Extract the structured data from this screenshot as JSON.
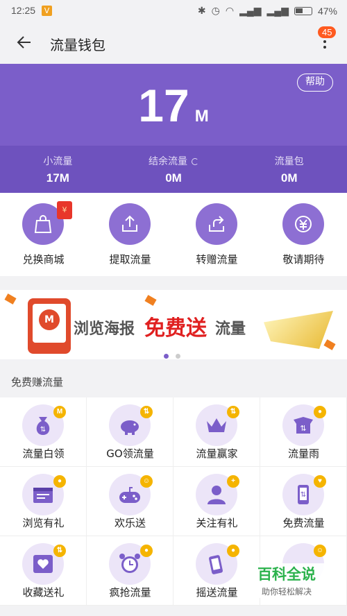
{
  "status_bar": {
    "time": "12:25",
    "notif_badge": "V",
    "battery": "47%"
  },
  "header": {
    "title": "流量钱包",
    "notif_count": "45"
  },
  "hero": {
    "help_label": "帮助",
    "amount": "17",
    "unit": "M",
    "stats": [
      {
        "label": "小流量",
        "value": "17M"
      },
      {
        "label": "结余流量",
        "value": "0M"
      },
      {
        "label": "流量包",
        "value": "0M"
      }
    ]
  },
  "actions": [
    {
      "label": "兑换商城",
      "icon": "shopping-bag-icon",
      "extra": "¥"
    },
    {
      "label": "提取流量",
      "icon": "upload-icon"
    },
    {
      "label": "转赠流量",
      "icon": "share-icon"
    },
    {
      "label": "敬请期待",
      "icon": "yuan-coin-icon"
    }
  ],
  "banner": {
    "text_before": "浏览海报",
    "text_highlight": "免费送",
    "text_after": "流量",
    "logo_letter": "M"
  },
  "earn_section": {
    "title": "免费赚流量",
    "items": [
      {
        "label": "流量白领",
        "icon": "money-bag-icon",
        "badge": "M"
      },
      {
        "label": "GO领流量",
        "icon": "piggy-bank-icon",
        "badge": "⇅"
      },
      {
        "label": "流量赢家",
        "icon": "crown-icon",
        "badge": "⇅"
      },
      {
        "label": "流量雨",
        "icon": "rain-icon",
        "badge": "●"
      },
      {
        "label": "浏览有礼",
        "icon": "browser-window-icon",
        "badge": "●"
      },
      {
        "label": "欢乐送",
        "icon": "gamepad-icon",
        "badge": "☺"
      },
      {
        "label": "关注有礼",
        "icon": "user-follow-icon",
        "badge": "+"
      },
      {
        "label": "免费流量",
        "icon": "phone-data-icon",
        "badge": "♥"
      },
      {
        "label": "收藏送礼",
        "icon": "heart-card-icon",
        "badge": "⇅"
      },
      {
        "label": "疯抢流量",
        "icon": "alarm-clock-icon",
        "badge": "●"
      },
      {
        "label": "摇送流量",
        "icon": "shake-phone-icon",
        "badge": "●"
      },
      {
        "label": "",
        "icon": "smile-icon",
        "badge": "☺"
      }
    ]
  },
  "watermark": {
    "title": "百科全说",
    "subtitle": "助你轻松解决"
  },
  "colors": {
    "primary": "#7b5ec9",
    "primary_dark": "#6e52be",
    "badge": "#f5b400",
    "alert": "#ff5a1f"
  }
}
